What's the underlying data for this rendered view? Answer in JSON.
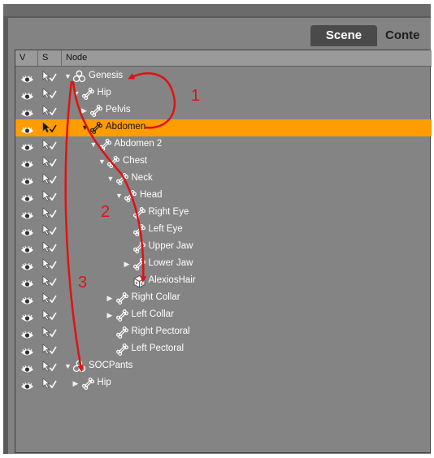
{
  "tabs": [
    {
      "label": "Scene"
    },
    {
      "label": "Conte"
    }
  ],
  "columns": {
    "visible": "V",
    "selectable": "S",
    "node": "Node"
  },
  "rows": [
    {
      "label": "Genesis",
      "indent": 0,
      "expander": "open",
      "icon": "figure-icon",
      "selected": false
    },
    {
      "label": "Hip",
      "indent": 1,
      "expander": "open",
      "icon": "bone-icon",
      "selected": false
    },
    {
      "label": "Pelvis",
      "indent": 2,
      "expander": "closed",
      "icon": "bone-icon",
      "selected": false
    },
    {
      "label": "Abdomen",
      "indent": 2,
      "expander": "open",
      "icon": "bone-icon",
      "selected": true
    },
    {
      "label": "Abdomen 2",
      "indent": 3,
      "expander": "open",
      "icon": "bone-icon",
      "selected": false
    },
    {
      "label": "Chest",
      "indent": 4,
      "expander": "open",
      "icon": "bone-icon",
      "selected": false
    },
    {
      "label": "Neck",
      "indent": 5,
      "expander": "open",
      "icon": "bone-icon",
      "selected": false
    },
    {
      "label": "Head",
      "indent": 6,
      "expander": "open",
      "icon": "bone-icon",
      "selected": false
    },
    {
      "label": "Right Eye",
      "indent": 7,
      "expander": "none",
      "icon": "bone-icon",
      "selected": false
    },
    {
      "label": "Left Eye",
      "indent": 7,
      "expander": "none",
      "icon": "bone-icon",
      "selected": false
    },
    {
      "label": "Upper Jaw",
      "indent": 7,
      "expander": "none",
      "icon": "bone-icon",
      "selected": false
    },
    {
      "label": "Lower Jaw",
      "indent": 7,
      "expander": "closed",
      "icon": "bone-icon",
      "selected": false
    },
    {
      "label": "AlexiosHair",
      "indent": 7,
      "expander": "none",
      "icon": "cube-icon",
      "selected": false
    },
    {
      "label": "Right Collar",
      "indent": 5,
      "expander": "closed",
      "icon": "bone-icon",
      "selected": false
    },
    {
      "label": "Left Collar",
      "indent": 5,
      "expander": "closed",
      "icon": "bone-icon",
      "selected": false
    },
    {
      "label": "Right Pectoral",
      "indent": 5,
      "expander": "none",
      "icon": "bone-icon",
      "selected": false
    },
    {
      "label": "Left Pectoral",
      "indent": 5,
      "expander": "none",
      "icon": "bone-icon",
      "selected": false
    },
    {
      "label": "SOCPants",
      "indent": 0,
      "expander": "open",
      "icon": "figure-icon",
      "selected": false
    },
    {
      "label": "Hip",
      "indent": 1,
      "expander": "closed",
      "icon": "bone-icon",
      "selected": false
    }
  ],
  "annotations": [
    "1",
    "2",
    "3"
  ],
  "colors": {
    "selection": "#ff9c00",
    "annotation": "#e01212"
  }
}
